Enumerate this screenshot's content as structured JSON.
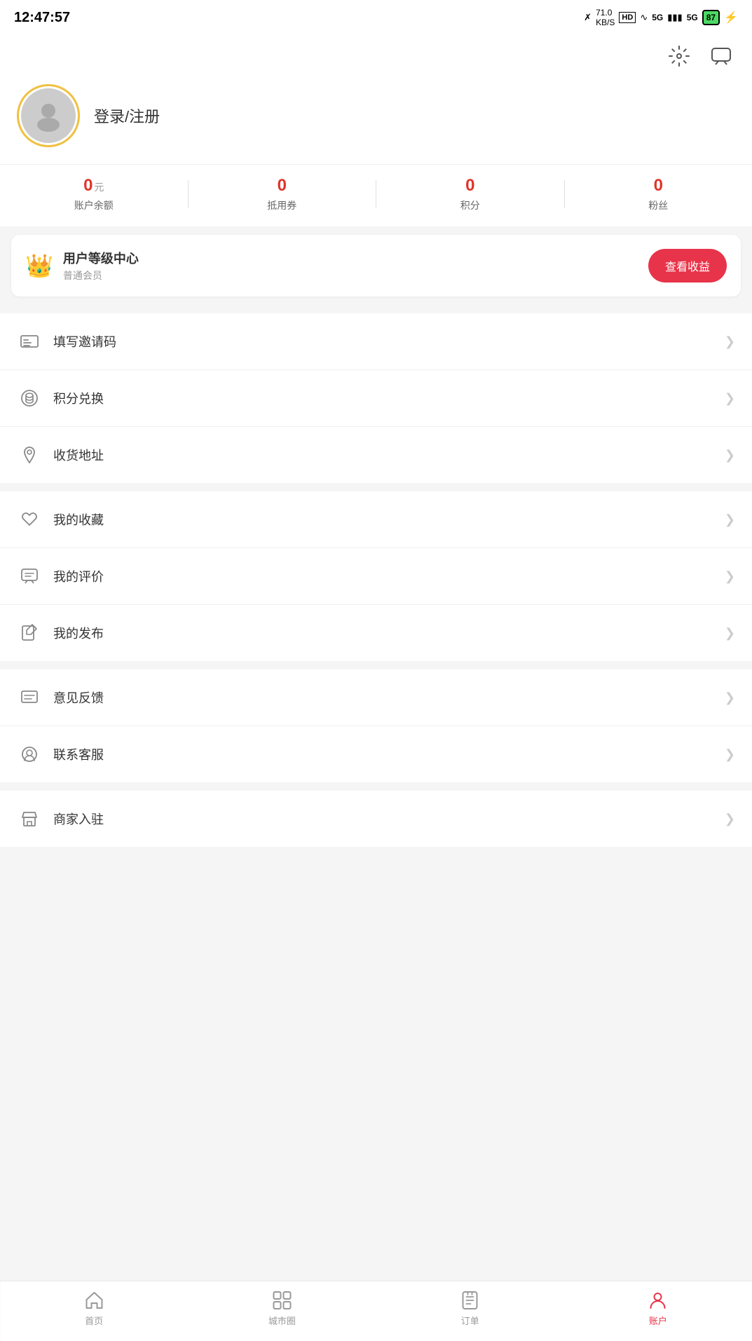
{
  "statusBar": {
    "time": "12:47:57",
    "battery": "87"
  },
  "header": {
    "settingsLabel": "settings",
    "messageLabel": "message"
  },
  "profile": {
    "loginText": "登录/注册"
  },
  "stats": [
    {
      "id": "balance",
      "value": "0",
      "unit": "元",
      "label": "账户余额"
    },
    {
      "id": "coupon",
      "value": "0",
      "unit": "",
      "label": "抵用券"
    },
    {
      "id": "points",
      "value": "0",
      "unit": "",
      "label": "积分"
    },
    {
      "id": "fans",
      "value": "0",
      "unit": "",
      "label": "粉丝"
    }
  ],
  "vipCard": {
    "title": "用户等级中心",
    "subtitle": "普通会员",
    "buttonLabel": "查看收益"
  },
  "menuGroups": [
    {
      "items": [
        {
          "id": "invite-code",
          "label": "填写邀请码",
          "icon": "menu-icon"
        },
        {
          "id": "points-exchange",
          "label": "积分兑换",
          "icon": "coins-icon"
        },
        {
          "id": "shipping-address",
          "label": "收货地址",
          "icon": "location-icon"
        }
      ]
    },
    {
      "items": [
        {
          "id": "favorites",
          "label": "我的收藏",
          "icon": "star-icon"
        },
        {
          "id": "reviews",
          "label": "我的评价",
          "icon": "comment-icon"
        },
        {
          "id": "my-posts",
          "label": "我的发布",
          "icon": "edit-icon"
        }
      ]
    },
    {
      "items": [
        {
          "id": "feedback",
          "label": "意见反馈",
          "icon": "feedback-icon"
        },
        {
          "id": "customer-service",
          "label": "联系客服",
          "icon": "service-icon"
        }
      ]
    },
    {
      "items": [
        {
          "id": "merchant-join",
          "label": "商家入驻",
          "icon": "flag-icon"
        }
      ]
    }
  ],
  "bottomNav": [
    {
      "id": "home",
      "label": "首页",
      "active": false
    },
    {
      "id": "city-circle",
      "label": "城市圈",
      "active": false
    },
    {
      "id": "orders",
      "label": "订单",
      "active": false
    },
    {
      "id": "account",
      "label": "账户",
      "active": true
    }
  ],
  "colors": {
    "accent": "#e8344a",
    "gold": "#f0a020",
    "borderColor": "#f0f0f0"
  }
}
